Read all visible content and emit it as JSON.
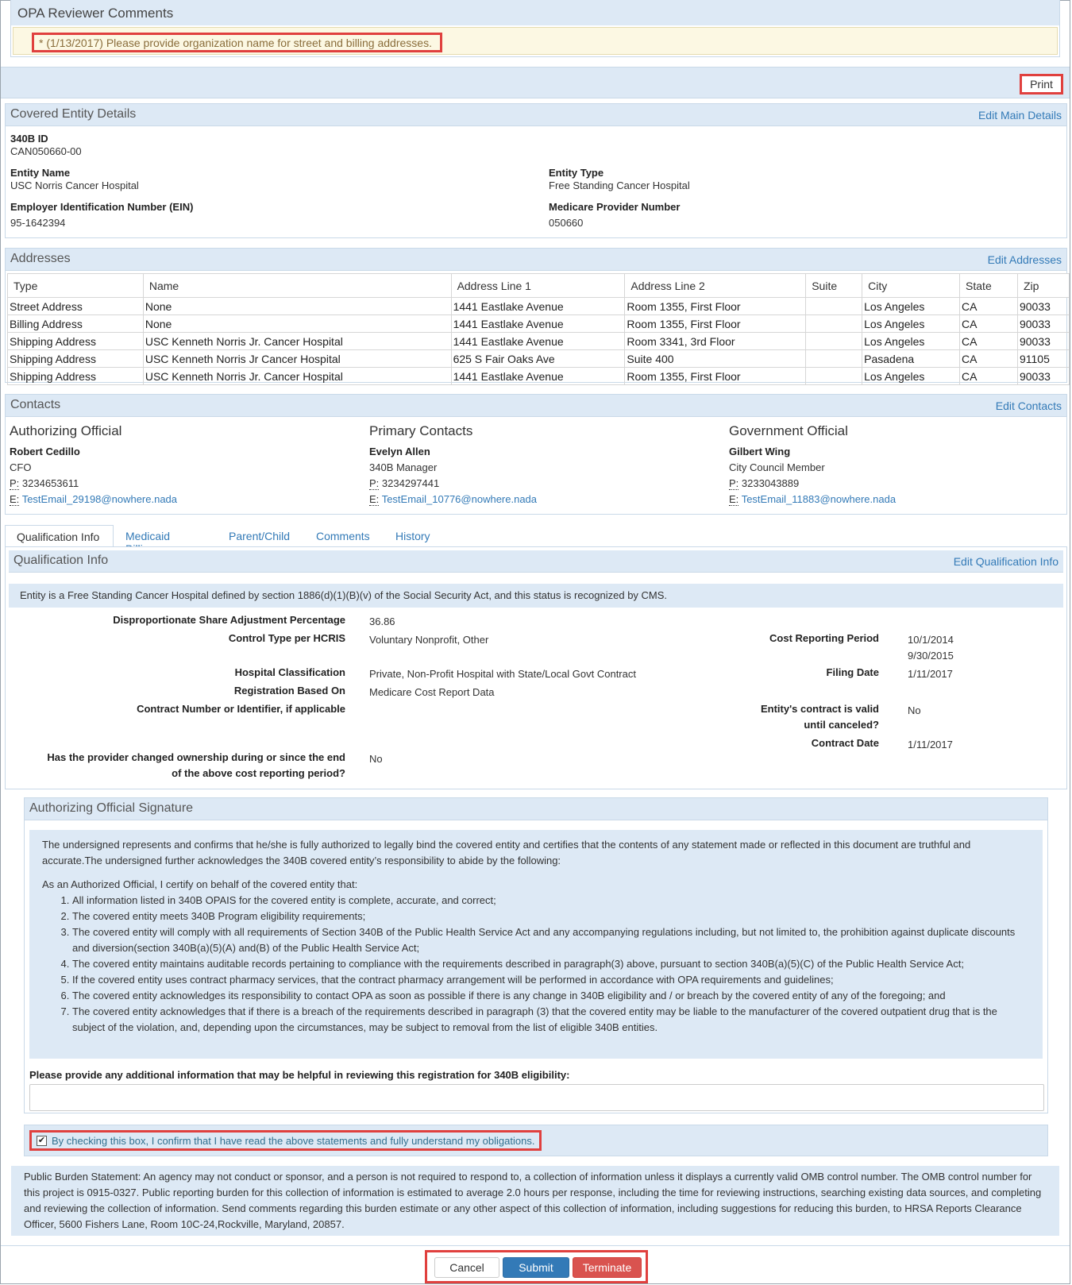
{
  "reviewer": {
    "title": "OPA Reviewer Comments",
    "comment": "* (1/13/2017) Please provide organization name for street and billing addresses."
  },
  "toolbar": {
    "print_label": "Print"
  },
  "entity": {
    "title": "Covered Entity Details",
    "edit_label": "Edit Main Details",
    "id_label": "340B ID",
    "id_value": "CAN050660-00",
    "name_label": "Entity Name",
    "name_value": "USC Norris Cancer Hospital",
    "type_label": "Entity Type",
    "type_value": "Free Standing Cancer Hospital",
    "ein_label": "Employer Identification Number (EIN)",
    "ein_value": "95-1642394",
    "medicare_label": "Medicare Provider Number",
    "medicare_value": "050660"
  },
  "addresses": {
    "title": "Addresses",
    "edit_label": "Edit Addresses",
    "columns": [
      "Type",
      "Name",
      "Address Line 1",
      "Address Line 2",
      "Suite",
      "City",
      "State",
      "Zip"
    ],
    "rows": [
      [
        "Street Address",
        "None",
        "1441 Eastlake Avenue",
        "Room 1355, First Floor",
        "",
        "Los Angeles",
        "CA",
        "90033"
      ],
      [
        "Billing Address",
        "None",
        "1441 Eastlake Avenue",
        "Room 1355, First Floor",
        "",
        "Los Angeles",
        "CA",
        "90033"
      ],
      [
        "Shipping Address",
        "USC Kenneth Norris Jr. Cancer Hospital",
        "1441 Eastlake Avenue",
        "Room 3341, 3rd Floor",
        "",
        "Los Angeles",
        "CA",
        "90033"
      ],
      [
        "Shipping Address",
        "USC Kenneth Norris Jr Cancer Hospital",
        "625 S Fair Oaks Ave",
        "Suite 400",
        "",
        "Pasadena",
        "CA",
        "91105"
      ],
      [
        "Shipping Address",
        "USC Kenneth Norris Jr. Cancer Hospital",
        "1441 Eastlake Avenue",
        "Room 1355, First Floor",
        "",
        "Los Angeles",
        "CA",
        "90033"
      ]
    ]
  },
  "contacts": {
    "title": "Contacts",
    "edit_label": "Edit Contacts",
    "phone_prefix": "P:",
    "email_prefix": "E:",
    "authorizing": {
      "heading": "Authorizing Official",
      "name": "Robert Cedillo",
      "role": "CFO",
      "phone": "3234653611",
      "email": "TestEmail_29198@nowhere.nada"
    },
    "primary": {
      "heading": "Primary Contacts",
      "name": "Evelyn Allen",
      "role": "340B Manager",
      "phone": "3234297441",
      "email": "TestEmail_10776@nowhere.nada"
    },
    "government": {
      "heading": "Government Official",
      "name": "Gilbert Wing",
      "role": "City Council Member",
      "phone": "3233043889",
      "email": "TestEmail_11883@nowhere.nada"
    }
  },
  "tabs": [
    "Qualification Info",
    "Medicaid Billing",
    "Parent/Child",
    "Comments",
    "History"
  ],
  "qualification": {
    "title": "Qualification Info",
    "edit_label": "Edit Qualification Info",
    "banner": "Entity is a Free Standing Cancer Hospital defined by section 1886(d)(1)(B)(v) of the Social Security Act, and this status is recognized by CMS.",
    "dsh_label": "Disproportionate Share Adjustment Percentage",
    "dsh_value": "36.86",
    "control_label": "Control Type per HCRIS",
    "control_value": "Voluntary Nonprofit, Other",
    "cost_label": "Cost Reporting Period",
    "cost_start": "10/1/2014",
    "cost_end": "9/30/2015",
    "class_label": "Hospital Classification",
    "class_value": "Private, Non-Profit Hospital with State/Local Govt Contract",
    "filing_label": "Filing Date",
    "filing_value": "1/11/2017",
    "reg_label": "Registration Based On",
    "reg_value": "Medicare Cost Report Data",
    "contract_label": "Contract Number or Identifier, if applicable",
    "valid_label_1": "Entity's contract is valid",
    "valid_label_2": "until canceled?",
    "valid_value": "No",
    "cdate_label": "Contract Date",
    "cdate_value": "1/11/2017",
    "owner_label_1": "Has the provider changed ownership during or since the end",
    "owner_label_2": "of the above cost reporting period?",
    "owner_value": "No"
  },
  "signature": {
    "title": "Authorizing Official Signature",
    "intro": "The undersigned represents and confirms that he/she is fully authorized to legally bind the covered entity and certifies that the contents of any statement made or reflected in this document are truthful and accurate.The undersigned further acknowledges the 340B covered entity’s responsibility to abide by the following:",
    "certify": "As an Authorized Official, I certify on behalf of the covered entity that:",
    "items": [
      "All information listed in 340B OPAIS for the covered entity is complete, accurate, and correct;",
      "The covered entity meets 340B Program eligibility requirements;",
      "The covered entity will comply with all requirements of Section 340B of the Public Health Service Act and any accompanying regulations including, but not limited to, the prohibition against duplicate discounts and diversion(section 340B(a)(5)(A) and(B) of the Public Health Service Act;",
      "The covered entity maintains auditable records pertaining to compliance with the requirements described in paragraph(3) above, pursuant to section 340B(a)(5)(C) of the Public Health Service Act;",
      "If the covered entity uses contract pharmacy services, that the contract pharmacy arrangement will be performed in accordance with OPA requirements and guidelines;",
      "The covered entity acknowledges its responsibility to contact OPA as soon as possible if there is any change in 340B eligibility and / or breach by the covered entity of any of the foregoing; and",
      "The covered entity acknowledges that if there is a breach of the requirements described in paragraph (3) that the covered entity may be liable to the manufacturer of the covered outpatient drug that is the subject of the violation, and, depending upon the circumstances, may be subject to removal from the list of eligible 340B entities."
    ],
    "additional_label": "Please provide any additional information that may be helpful in reviewing this registration for 340B eligibility:",
    "additional_value": ""
  },
  "confirm": {
    "label": "By checking this box, I confirm that I have read the above statements and fully understand my obligations.",
    "checked": true
  },
  "burden": "Public Burden Statement: An agency may not conduct or sponsor, and a person is not required to respond to, a collection of information unless it displays a currently valid OMB control number. The OMB control number for this project is 0915-0327. Public reporting burden for this collection of information is estimated to average 2.0 hours per response, including the time for reviewing instructions, searching existing data sources, and completing and reviewing the collection of information. Send comments regarding this burden estimate or any other aspect of this collection of information, including suggestions for reducing this burden, to HRSA Reports Clearance Officer, 5600 Fishers Lane, Room 10C-24,Rockville, Maryland, 20857.",
  "actions": {
    "cancel": "Cancel",
    "submit": "Submit",
    "terminate": "Terminate"
  },
  "colors": {
    "accent": "#337ab7",
    "panel_head": "#dde9f5",
    "danger": "#d9534f",
    "primary": "#337ab7",
    "highlight": "#e0403e"
  }
}
